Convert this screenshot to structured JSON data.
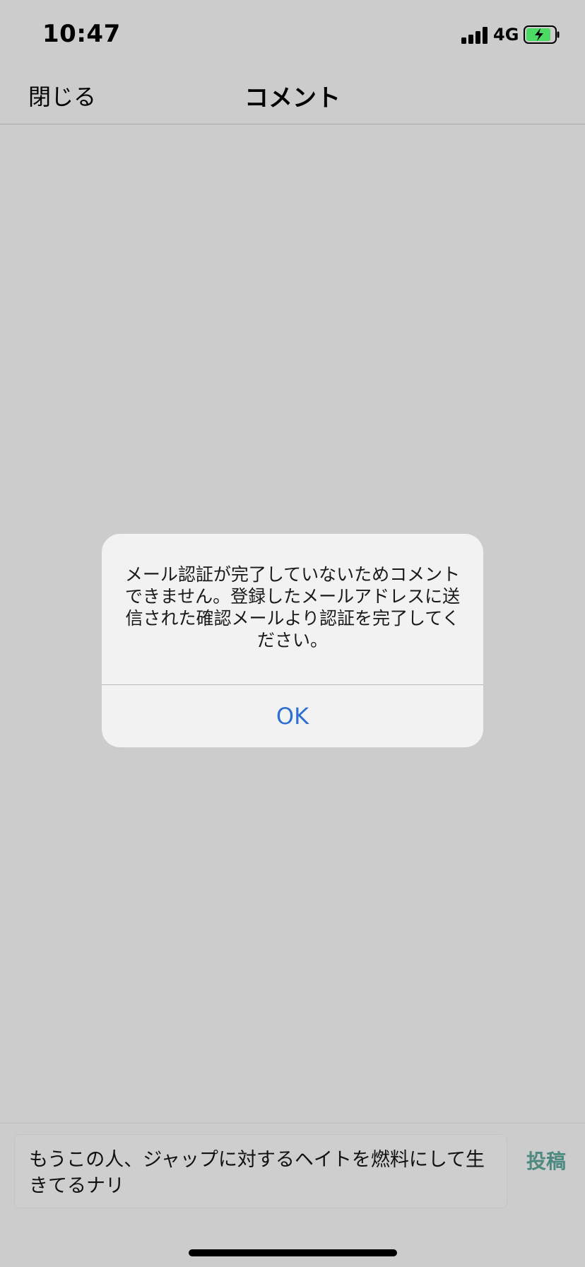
{
  "status_bar": {
    "time": "10:47",
    "network": "4G",
    "battery_color": "#4cd964",
    "icons": [
      "signal-icon",
      "battery-charging-icon"
    ]
  },
  "nav": {
    "close_label": "閉じる",
    "title": "コメント"
  },
  "alert": {
    "message": "メール認証が完了していないためコメントできません。登録したメールアドレスに送信された確認メールより認証を完了してください。",
    "ok_label": "OK",
    "ok_color": "#2f6fd1"
  },
  "compose": {
    "text": "もうこの人、ジャップに対するヘイトを燃料にして生きてるナリ",
    "post_label": "投稿",
    "post_color": "#4e8a80"
  }
}
